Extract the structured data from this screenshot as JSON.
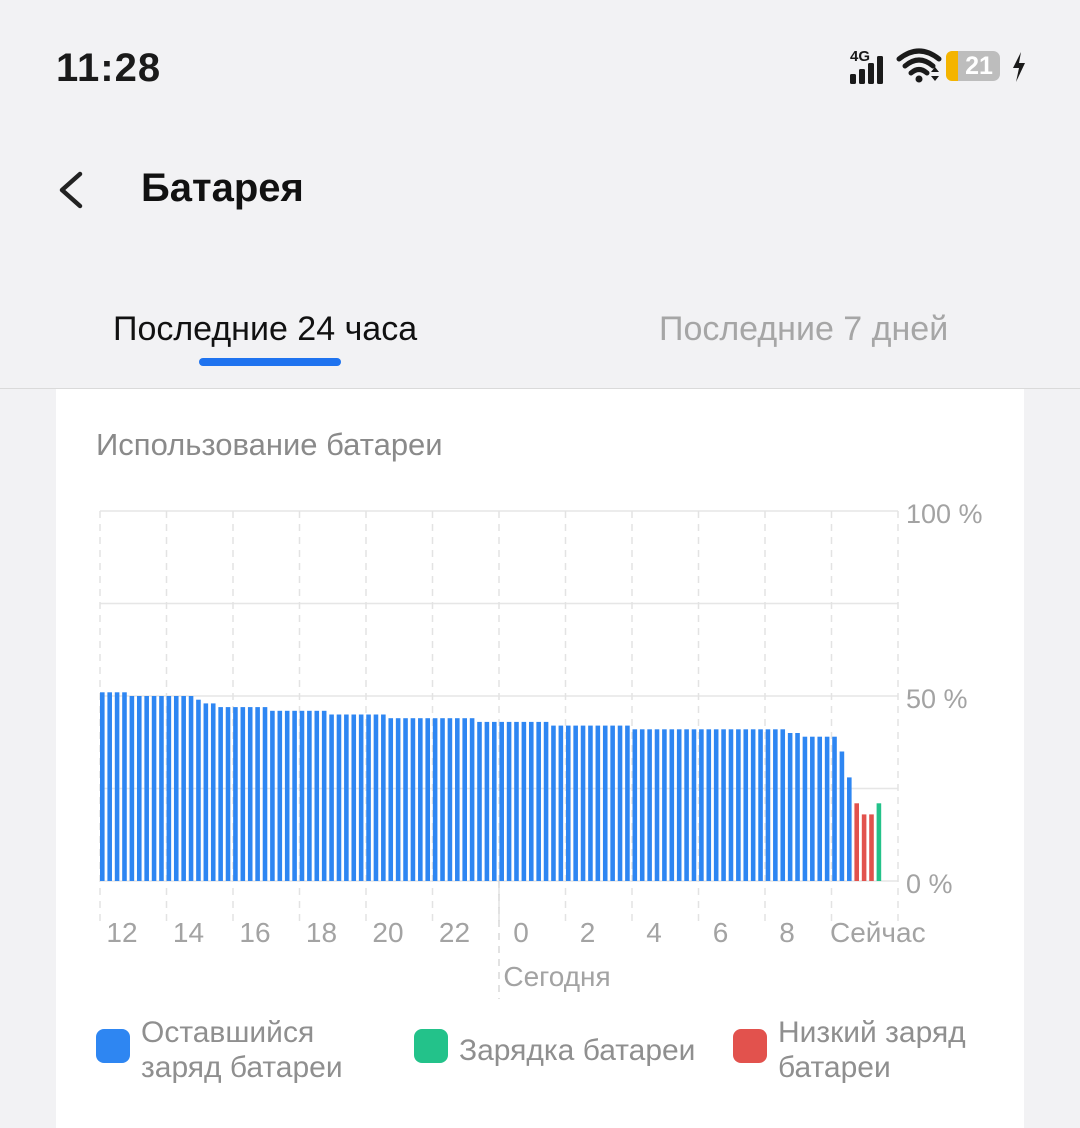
{
  "status_bar": {
    "time": "11:28",
    "network": "4G",
    "battery_level": "21",
    "icons": [
      "signal-icon",
      "wifi-icon",
      "battery-icon",
      "charging-bolt-icon"
    ]
  },
  "header": {
    "back_icon": "chevron-left-icon",
    "title": "Батарея"
  },
  "tabs": [
    {
      "label": "Последние 24 часа",
      "active": true
    },
    {
      "label": "Последние 7 дней",
      "active": false
    }
  ],
  "card": {
    "title": "Использование батареи"
  },
  "legend": [
    {
      "label": "Оставшийся заряд батареи",
      "color": "#2e86f2"
    },
    {
      "label": "Зарядка батареи",
      "color": "#23c28a"
    },
    {
      "label": "Низкий заряд батареи",
      "color": "#e2524d"
    }
  ],
  "colors": {
    "accent": "#1f73ef",
    "remaining": "#2e86f2",
    "charging": "#23c28a",
    "low": "#e2524d"
  },
  "chart_data": {
    "type": "bar",
    "title": "Использование батареи",
    "ylim": [
      0,
      100
    ],
    "y_ticks": [
      "100 %",
      "50 %",
      "0 %"
    ],
    "x_tick_labels": [
      "12",
      "14",
      "16",
      "18",
      "20",
      "22",
      "0",
      "2",
      "4",
      "6",
      "8",
      "Сейчас"
    ],
    "x_sublabel": "Сегодня",
    "grid": true,
    "series": [
      {
        "name": "Оставшийся заряд батареи",
        "color": "#2e86f2",
        "values": [
          51,
          51,
          51,
          51,
          50,
          50,
          50,
          50,
          50,
          50,
          50,
          50,
          50,
          49,
          48,
          48,
          47,
          47,
          47,
          47,
          47,
          47,
          47,
          46,
          46,
          46,
          46,
          46,
          46,
          46,
          46,
          45,
          45,
          45,
          45,
          45,
          45,
          45,
          45,
          44,
          44,
          44,
          44,
          44,
          44,
          44,
          44,
          44,
          44,
          44,
          44,
          43,
          43,
          43,
          43,
          43,
          43,
          43,
          43,
          43,
          43,
          42,
          42,
          42,
          42,
          42,
          42,
          42,
          42,
          42,
          42,
          42,
          41,
          41,
          41,
          41,
          41,
          41,
          41,
          41,
          41,
          41,
          41,
          41,
          41,
          41,
          41,
          41,
          41,
          41,
          41,
          41,
          41,
          40,
          40,
          39,
          39,
          39,
          39,
          39,
          35,
          28
        ]
      },
      {
        "name": "Низкий заряд батареи",
        "color": "#e2524d",
        "values": [
          21,
          18,
          18
        ]
      },
      {
        "name": "Зарядка батареи",
        "color": "#23c28a",
        "values": [
          21
        ]
      }
    ]
  }
}
